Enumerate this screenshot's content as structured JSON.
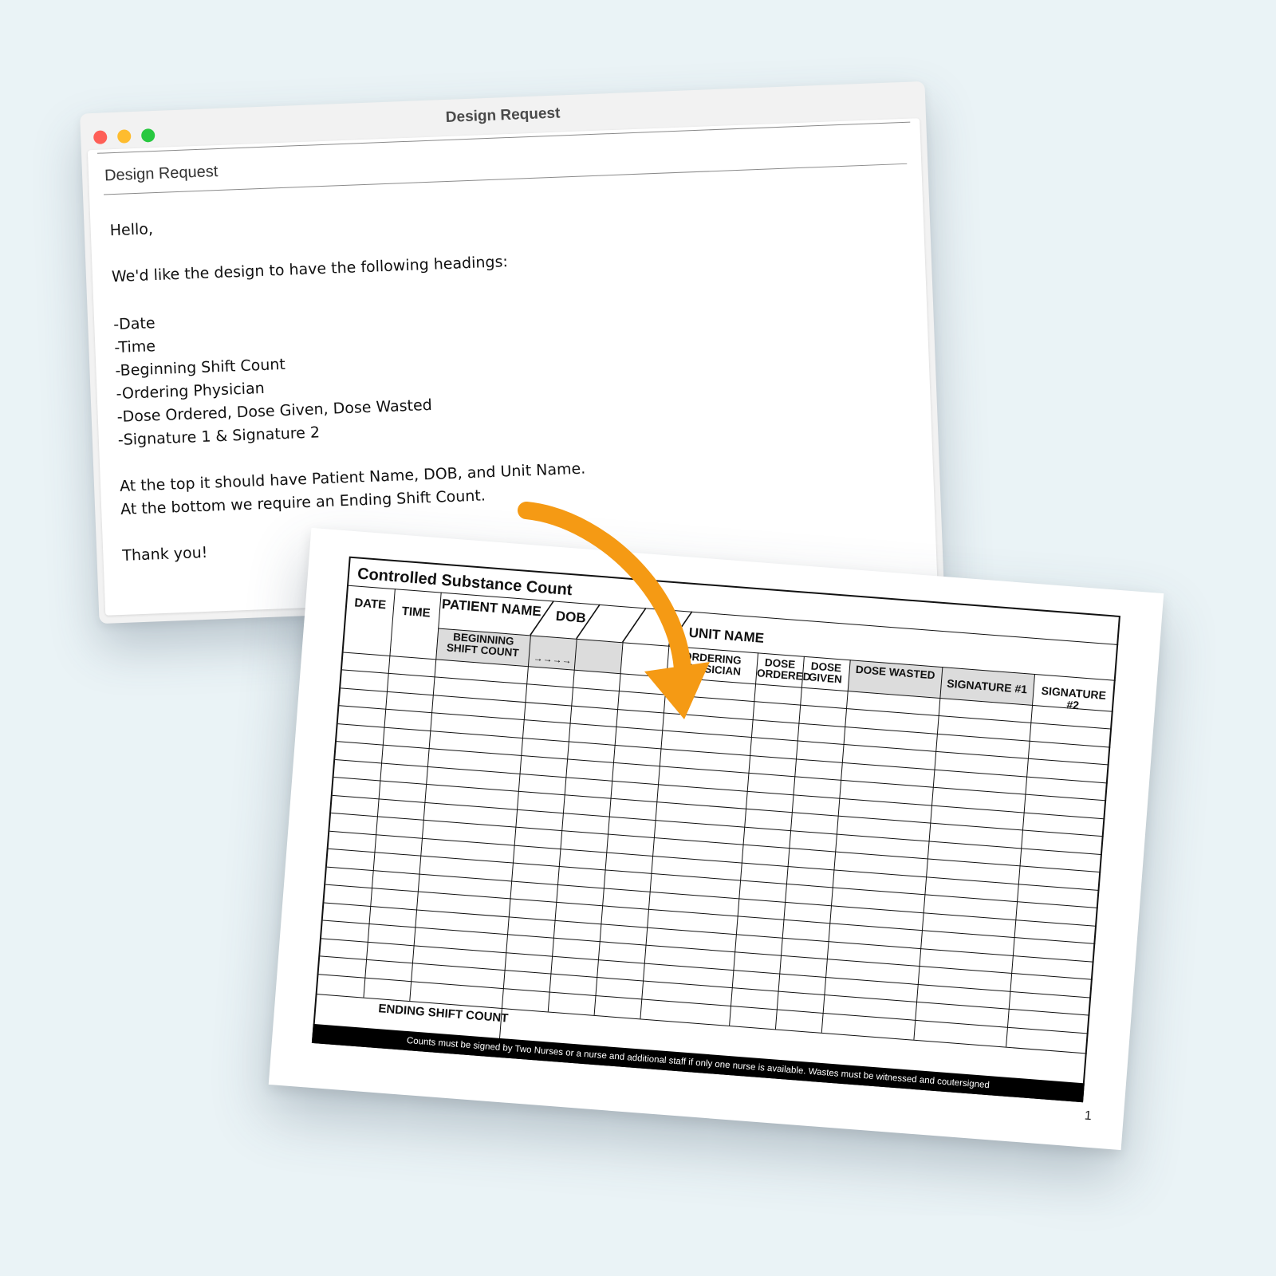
{
  "window": {
    "title": "Design Request",
    "subject": "Design Request",
    "body": {
      "greeting": "Hello,",
      "intro": "We'd like the design to have the following headings:",
      "headings": [
        "-Date",
        "-Time",
        "-Beginning Shift Count",
        "-Ordering Physician",
        "-Dose Ordered, Dose Given, Dose Wasted",
        "-Signature 1 & Signature 2"
      ],
      "top_note": "At the top it should have Patient Name, DOB, and Unit Name.",
      "bottom_note": "At the bottom we require an Ending Shift Count.",
      "closing": "Thank you!"
    }
  },
  "form": {
    "title": "Controlled Substance Count",
    "headers": {
      "date": "DATE",
      "time": "TIME",
      "patient_name": "PATIENT NAME",
      "dob": "DOB",
      "unit_name": "UNIT NAME",
      "beginning_shift_count": "BEGINNING SHIFT COUNT",
      "arrows": "→→→→",
      "ordering_physician": "ORDERING PHYSICIAN",
      "dose_ordered": "DOSE ORDERED",
      "dose_given": "DOSE GIVEN",
      "dose_wasted": "DOSE WASTED",
      "signature_1": "SIGNATURE #1",
      "signature_2": "SIGNATURE #2"
    },
    "ending_shift_count": "ENDING SHIFT COUNT",
    "footer": "Counts must be signed by Two Nurses or a nurse and additional staff if only one nurse is available.  Wastes must be witnessed and coutersigned",
    "page_number": "1"
  },
  "colors": {
    "background": "#eaf3f6",
    "arrow": "#f59a14",
    "header_shade": "#dcdcdc",
    "close_light": "#fe5f57",
    "minimize_light": "#febc2e",
    "zoom_light": "#28c840"
  }
}
